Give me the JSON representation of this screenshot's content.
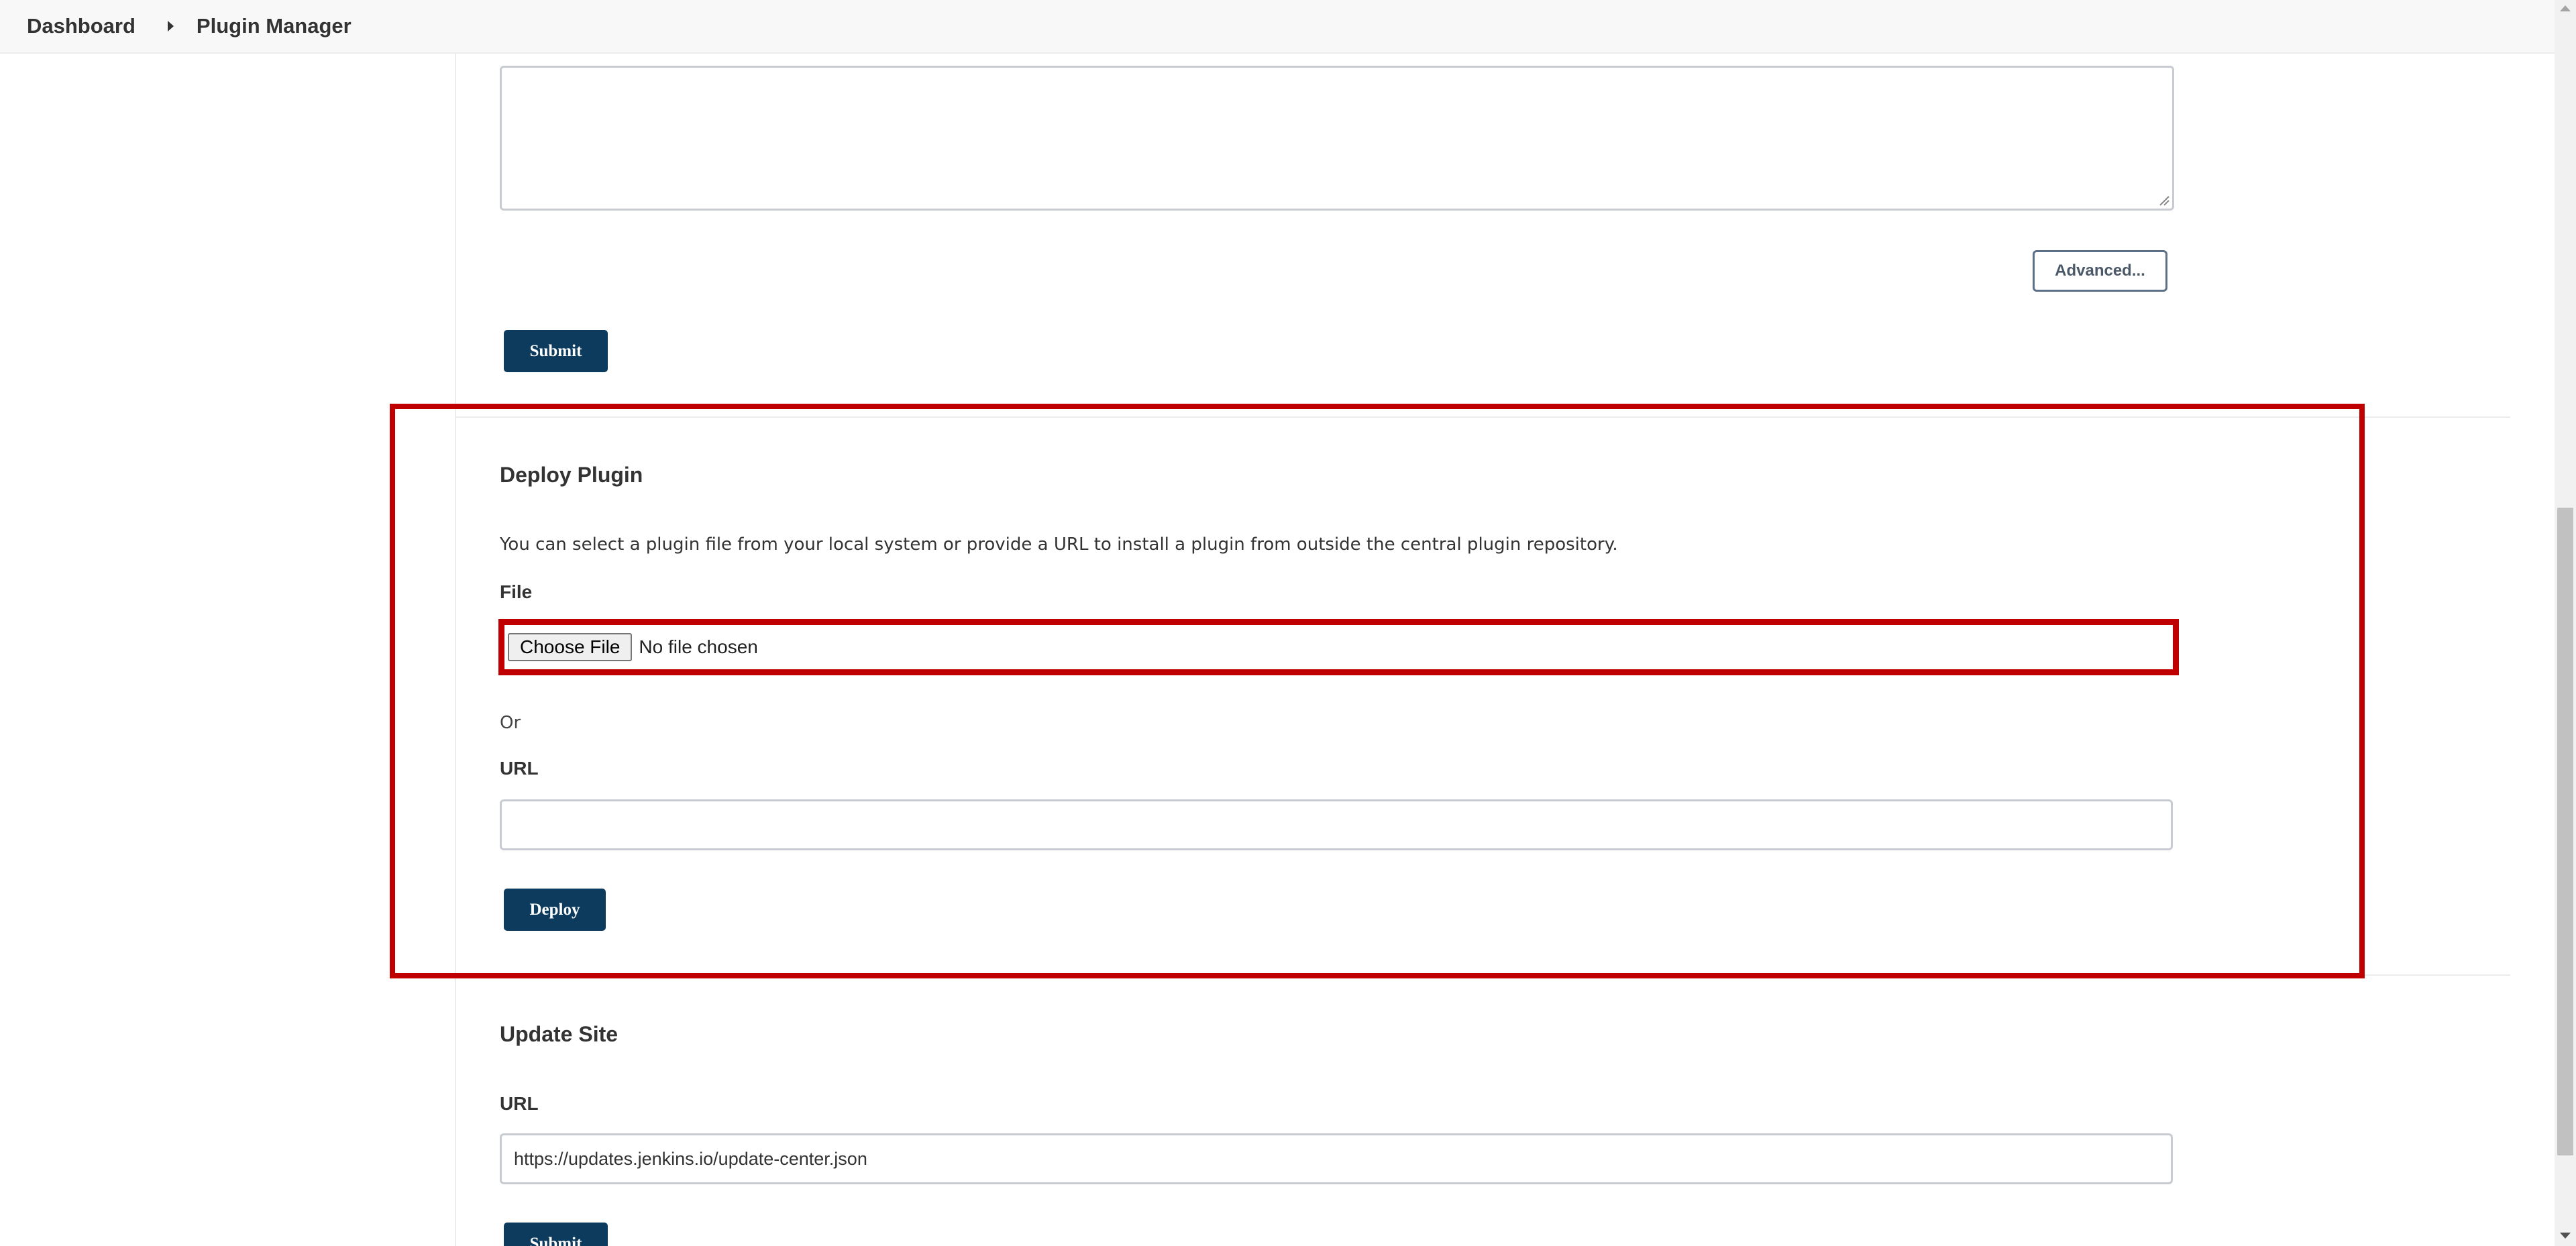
{
  "breadcrumb": {
    "items": [
      "Dashboard",
      "Plugin Manager"
    ]
  },
  "advanced_section": {
    "textarea_value": "",
    "advanced_label": "Advanced...",
    "submit_label": "Submit"
  },
  "deploy_plugin": {
    "title": "Deploy Plugin",
    "description": "You can select a plugin file from your local system or provide a URL to install a plugin from outside the central plugin repository.",
    "file_label": "File",
    "choose_file_label": "Choose File",
    "no_file_text": "No file chosen",
    "or_text": "Or",
    "url_label": "URL",
    "url_value": "",
    "deploy_label": "Deploy"
  },
  "update_site": {
    "title": "Update Site",
    "url_label": "URL",
    "url_value": "https://updates.jenkins.io/update-center.json",
    "submit_label": "Submit"
  },
  "colors": {
    "primary_button": "#0d3b5e",
    "highlight": "#c00000"
  },
  "icons": {
    "breadcrumb_separator": "caret-right-icon",
    "textarea_resize": "resize-grip-icon"
  }
}
